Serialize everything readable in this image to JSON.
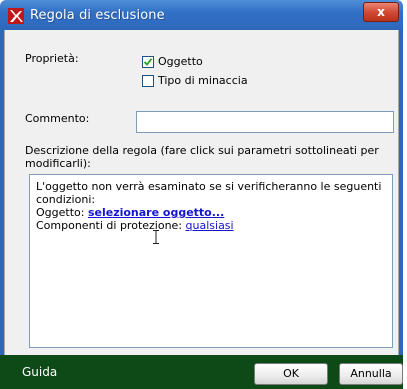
{
  "window": {
    "title": "Regola di esclusione",
    "close_label": "x"
  },
  "properties": {
    "label": "Proprietà:",
    "options": [
      {
        "label": "Oggetto",
        "checked": true
      },
      {
        "label": "Tipo di minaccia",
        "checked": false
      }
    ]
  },
  "comment": {
    "label": "Commento:",
    "value": ""
  },
  "description": {
    "label_line1": "Descrizione della regola (fare click sui parametri sottolineati per",
    "label_line2": "modificarli):",
    "line1": "L'oggetto non verrà esaminato se si verificheranno le seguenti",
    "line2": "condizioni:",
    "object_prefix": "Oggetto: ",
    "object_link": "selezionare oggetto...",
    "components_prefix": "Componenti di protezione: ",
    "components_link": "qualsiasi"
  },
  "footer": {
    "help_label": "Guida",
    "ok_label": "OK",
    "cancel_label": "Annulla"
  },
  "colors": {
    "titlebar": "#3270c6",
    "footer": "#0d4a17",
    "link": "#1515d0"
  }
}
